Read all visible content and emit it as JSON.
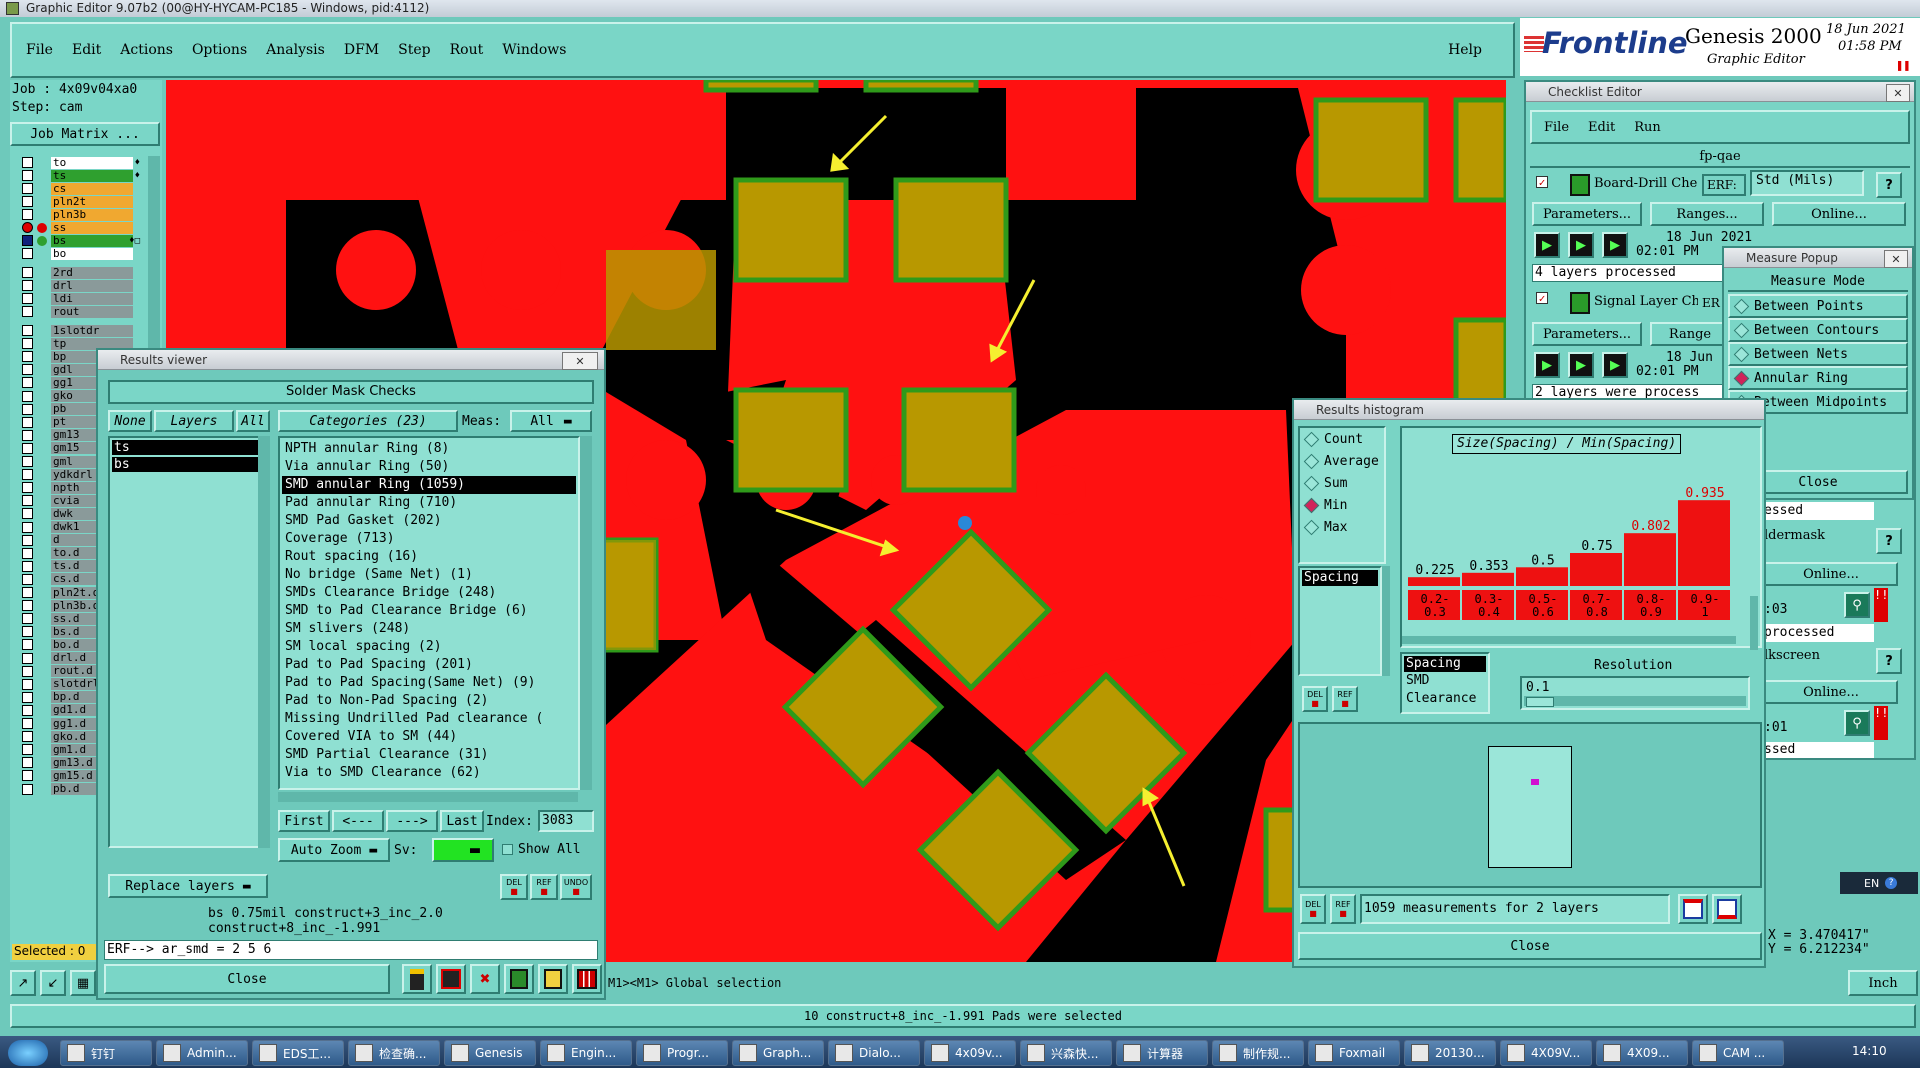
{
  "app": {
    "title": "Graphic Editor 9.07b2 (00@HY-HYCAM-PC185 - Windows, pid:4112)",
    "menu": [
      "File",
      "Edit",
      "Actions",
      "Options",
      "Analysis",
      "DFM",
      "Step",
      "Rout",
      "Windows"
    ],
    "help": "Help",
    "brand": "Frontline",
    "product": "Genesis 2000",
    "product_sub": "Graphic Editor",
    "date": "18 Jun 2021",
    "time": "01:58 PM"
  },
  "left_panel": {
    "job": "Job : 4x09v04xa0",
    "step": "Step: cam",
    "job_matrix": "Job Matrix ...",
    "selected_label": "Selected : 0"
  },
  "layers_top": [
    {
      "name": "to",
      "color": "#ffffff",
      "marker": "♦"
    },
    {
      "name": "ts",
      "color": "#2fa02f",
      "marker": "♦"
    },
    {
      "name": "cs",
      "color": "#f0a830",
      "marker": ""
    },
    {
      "name": "pln2t",
      "color": "#f0a830",
      "marker": ""
    },
    {
      "name": "pln3b",
      "color": "#f0a830",
      "marker": ""
    },
    {
      "name": "ss",
      "color": "#f0a830",
      "marker": ""
    },
    {
      "name": "bs",
      "color": "#2fa02f",
      "marker": "♦□"
    },
    {
      "name": "bo",
      "color": "#ffffff",
      "marker": ""
    }
  ],
  "layers_drill": [
    "2rd",
    "drl",
    "ldi",
    "rout"
  ],
  "layers_misc": [
    "1slotdr",
    "tp",
    "bp",
    "gdl",
    "gg1",
    "gko",
    "pb",
    "pt",
    "gm13",
    "gm15",
    "gml",
    "ydkdrl",
    "npth",
    "cvia",
    "dwk",
    "dwk1",
    "d",
    "to.d",
    "ts.d",
    "cs.d",
    "pln2t.d",
    "pln3b.d",
    "ss.d",
    "bs.d",
    "bo.d",
    "drl.d",
    "rout.d",
    "slotdrl",
    "bp.d",
    "gd1.d",
    "gg1.d",
    "gko.d",
    "gm1.d",
    "gm13.d",
    "gm15.d",
    "pb.d"
  ],
  "results_viewer": {
    "title": "Results viewer",
    "header": "Solder Mask Checks",
    "none_btn": "None",
    "layers_btn": "Layers",
    "all_btn": "All",
    "layers": [
      "ts",
      "bs"
    ],
    "categories_label": "Categories (23)",
    "meas_label": "Meas:",
    "meas_value": "All",
    "categories": [
      "NPTH annular Ring (8)",
      "Via annular Ring (50)",
      "SMD annular Ring (1059)",
      "Pad annular Ring (710)",
      "SMD Pad Gasket (202)",
      "Coverage (713)",
      "Rout spacing (16)",
      "No bridge (Same Net) (1)",
      "SMDs Clearance Bridge (248)",
      "SMD to Pad Clearance Bridge (6)",
      "SM slivers (248)",
      "SM local spacing (2)",
      "Pad to Pad Spacing (201)",
      "Pad to Pad Spacing(Same Net) (9)",
      "Pad to Non-Pad Spacing (2)",
      "Missing Undrilled Pad clearance (",
      "Covered VIA to SM (44)",
      "SMD Partial Clearance (31)",
      "Via to SMD Clearance (62)"
    ],
    "selected_index": 2,
    "nav": {
      "first": "First",
      "prev": "<---",
      "next": "--->",
      "last": "Last",
      "index_label": "Index:",
      "index_value": "3083"
    },
    "auto_zoom": "Auto Zoom",
    "sv_label": "Sv:",
    "show_all": "Show All",
    "replace_layers": "Replace layers",
    "info_line1": "bs 0.75mil  construct+3_inc_2.0",
    "info_line2": "construct+8_inc_-1.991",
    "erf_line": "ERF--> ar_smd = 2 5 6",
    "close": "Close",
    "icon_labels": {
      "del": "DEL",
      "ref": "REF",
      "undo": "UNDO"
    }
  },
  "checklist_editor": {
    "title": "Checklist Editor",
    "menu": [
      "File",
      "Edit",
      "Run"
    ],
    "name": "fp-qae",
    "items": [
      {
        "label": "Board-Drill Che",
        "erf": "ERF:",
        "std": "Std (Mils)",
        "params": "Parameters...",
        "ranges": "Ranges...",
        "online": "Online...",
        "date": "18 Jun 2021",
        "time": "02:01 PM",
        "status": "4 layers processed"
      },
      {
        "label": "Signal Layer Ch",
        "erf": "ER",
        "params": "Parameters...",
        "ranges": "Range",
        "date": "18 Jun",
        "time": "02:01 PM",
        "status": "2 layers were process"
      }
    ],
    "partial_right": [
      "essed",
      "ldermask",
      "Online...",
      ":03",
      "processed",
      "lkscreen",
      "Online...",
      ":01",
      "ssed"
    ]
  },
  "measure_popup": {
    "title": "Measure Popup",
    "header": "Measure Mode",
    "options": [
      "Between Points",
      "Between Contours",
      "Between Nets",
      "Annular Ring",
      "Between Midpoints"
    ],
    "selected": 3,
    "close": "Close"
  },
  "histogram": {
    "title": "Results histogram",
    "stats": [
      "Count",
      "Average",
      "Sum",
      "Min",
      "Max"
    ],
    "selected_stat": 3,
    "list_selected": "Spacing",
    "chart_title": "Size(Spacing) / Min(Spacing)",
    "bars": [
      {
        "value": "0.225",
        "range": "0.2-\n0.3",
        "fill": 0.08
      },
      {
        "value": "0.353",
        "range": "0.3-\n0.4",
        "fill": 0.12
      },
      {
        "value": "0.5",
        "range": "0.5-\n0.6",
        "fill": 0.17
      },
      {
        "value": "0.75",
        "range": "0.7-\n0.8",
        "fill": 0.3
      },
      {
        "value": "0.802",
        "range": "0.8-\n0.9",
        "fill": 0.48,
        "highlight": true
      },
      {
        "value": "0.935",
        "range": "0.9-\n1",
        "fill": 0.78,
        "highlight": true
      }
    ],
    "types": [
      "Spacing",
      "SMD",
      "Clearance"
    ],
    "resolution_label": "Resolution",
    "resolution_value": "0.1",
    "summary": "1059 measurements for 2 layers",
    "close": "Close"
  },
  "statusbar": {
    "mouse_hint": "M1><M1> Global selection",
    "message": "10 construct+8_inc_-1.991 Pads were selected",
    "coord_x": "X = 3.470417\"",
    "coord_y": "Y = 6.212234\"",
    "units": "Inch"
  },
  "taskbar": {
    "items": [
      "钉钉",
      "Admin...",
      "EDS工...",
      "检查确...",
      "Genesis",
      "Engin...",
      "Progr...",
      "Graph...",
      "Dialo...",
      "4x09v...",
      "兴森快...",
      "计算器",
      "制作规...",
      "Foxmail",
      "20130...",
      "4X09V...",
      "4X09...",
      "CAM ..."
    ],
    "clock": "14:10",
    "lang": "EN"
  }
}
